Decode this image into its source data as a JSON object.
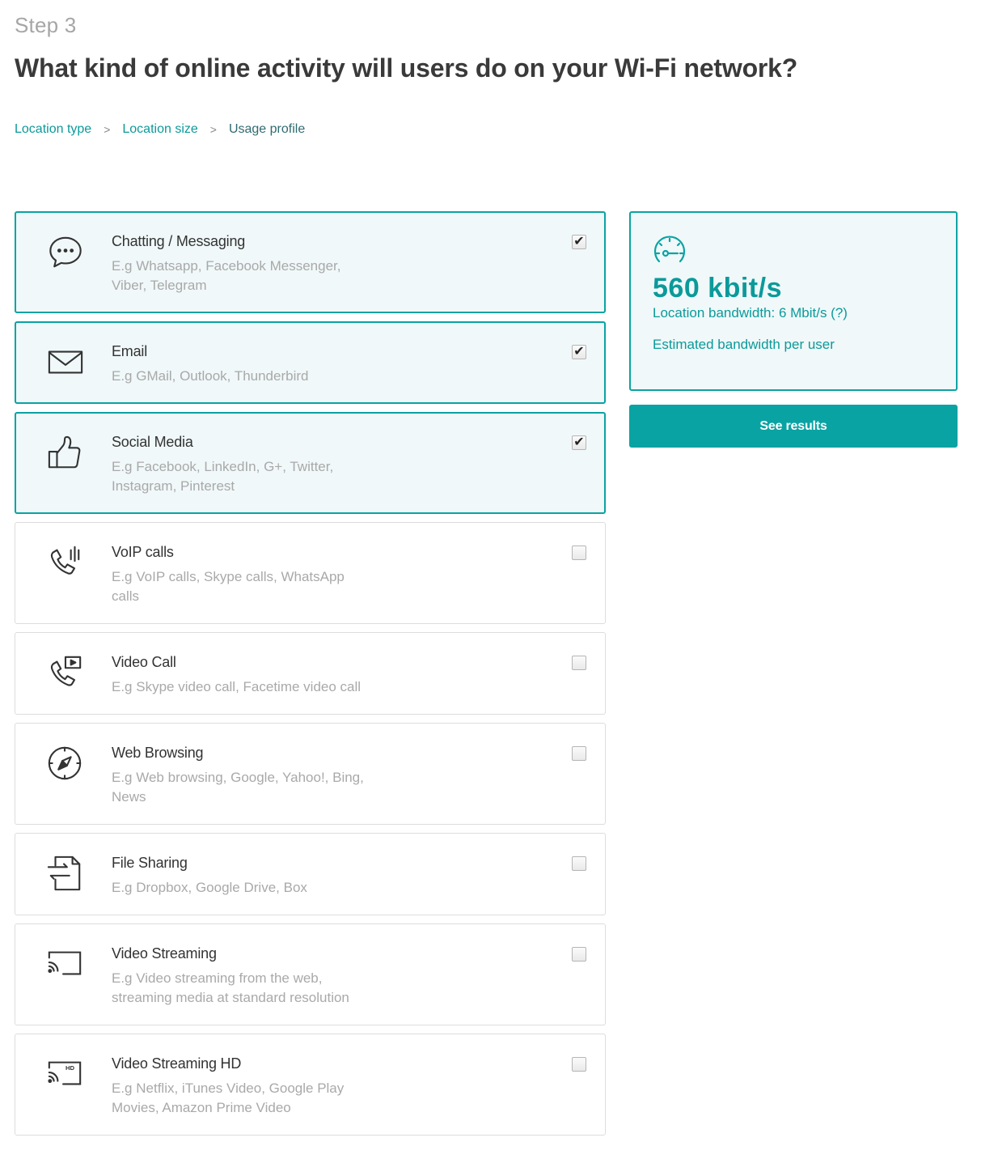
{
  "header": {
    "step": "Step 3",
    "title": "What kind of online activity will users do on your Wi-Fi network?"
  },
  "breadcrumb": [
    {
      "label": "Location type"
    },
    {
      "label": "Location size"
    },
    {
      "label": "Usage profile"
    }
  ],
  "breadcrumb_separator": ">",
  "activities": [
    {
      "icon": "chat-bubble-icon",
      "title": "Chatting / Messaging",
      "description": "E.g Whatsapp, Facebook Messenger, Viber, Telegram",
      "checked": true
    },
    {
      "icon": "envelope-icon",
      "title": "Email",
      "description": "E.g GMail, Outlook, Thunderbird",
      "checked": true
    },
    {
      "icon": "thumbs-up-icon",
      "title": "Social Media",
      "description": "E.g Facebook, LinkedIn, G+, Twitter, Instagram, Pinterest",
      "checked": true
    },
    {
      "icon": "voip-phone-icon",
      "title": "VoIP calls",
      "description": "E.g VoIP calls, Skype calls, WhatsApp calls",
      "checked": false
    },
    {
      "icon": "video-call-icon",
      "title": "Video Call",
      "description": "E.g Skype video call, Facetime video call",
      "checked": false
    },
    {
      "icon": "compass-icon",
      "title": "Web Browsing",
      "description": "E.g Web browsing, Google, Yahoo!, Bing, News",
      "checked": false
    },
    {
      "icon": "file-transfer-icon",
      "title": "File Sharing",
      "description": "E.g Dropbox, Google Drive, Box",
      "checked": false
    },
    {
      "icon": "cast-screen-icon",
      "title": "Video Streaming",
      "description": "E.g Video streaming from the web, streaming media at standard resolution",
      "checked": false
    },
    {
      "icon": "cast-hd-icon",
      "title": "Video Streaming HD",
      "description": "E.g Netflix, iTunes Video, Google Play Movies, Amazon Prime Video",
      "checked": false
    }
  ],
  "checkmark_glyph": "✔",
  "result": {
    "gauge_icon": "speedometer-icon",
    "value": "560  kbit/s",
    "location_bandwidth": "Location bandwidth: 6 Mbit/s (?)",
    "caption": "Estimated bandwidth per user"
  },
  "see_results_label": "See results",
  "colors": {
    "accent": "#0aa3a3",
    "selected_bg": "#f0f8f9",
    "muted_text": "#a9a9a9"
  }
}
